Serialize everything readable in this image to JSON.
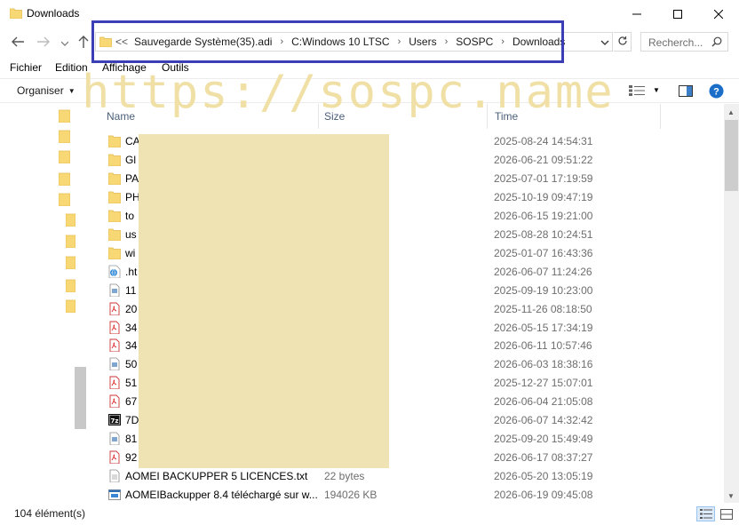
{
  "window": {
    "title": "Downloads",
    "folder_icon": "folder-icon"
  },
  "navigation": {
    "address_overflow": "<<",
    "breadcrumbs": [
      "Sauvegarde Système(35).adi",
      "C:Windows 10 LTSC",
      "Users",
      "SOSPC",
      "Downloads"
    ],
    "search_placeholder": "Recherch..."
  },
  "menu": {
    "items": [
      "Fichier",
      "Edition",
      "Affichage",
      "Outils"
    ]
  },
  "command_bar": {
    "organise_label": "Organiser"
  },
  "watermark": "https://sospc.name",
  "columns": {
    "name": "Name",
    "size": "Size",
    "time": "Time"
  },
  "files": [
    {
      "name": "CA",
      "size": "",
      "time": "2025-08-24 14:54:31",
      "icon": "folder-icon"
    },
    {
      "name": "Gl",
      "size": "",
      "time": "2026-06-21 09:51:22",
      "icon": "folder-icon"
    },
    {
      "name": "PA",
      "size": "",
      "time": "2025-07-01 17:19:59",
      "icon": "folder-icon"
    },
    {
      "name": "PH",
      "size": "",
      "time": "2025-10-19 09:47:19",
      "icon": "folder-icon"
    },
    {
      "name": "to",
      "size": "",
      "time": "2026-06-15 19:21:00",
      "icon": "folder-icon"
    },
    {
      "name": "us",
      "size": "",
      "time": "2025-08-28 10:24:51",
      "icon": "folder-icon"
    },
    {
      "name": "wi",
      "size": "",
      "time": "2025-01-07 16:43:36",
      "icon": "folder-icon"
    },
    {
      "name": ".ht",
      "size": "",
      "time": "2026-06-07 11:24:26",
      "icon": "html-file-icon"
    },
    {
      "name": "11",
      "size": "",
      "time": "2025-09-19 10:23:00",
      "icon": "image-file-icon"
    },
    {
      "name": "20",
      "size": "",
      "time": "2025-11-26 08:18:50",
      "icon": "pdf-file-icon"
    },
    {
      "name": "34",
      "size": "",
      "time": "2026-05-15 17:34:19",
      "icon": "pdf-file-icon"
    },
    {
      "name": "34",
      "size": "",
      "time": "2026-06-11 10:57:46",
      "icon": "pdf-file-icon"
    },
    {
      "name": "50",
      "size": "",
      "time": "2026-06-03 18:38:16",
      "icon": "image-file-icon"
    },
    {
      "name": "51",
      "size": "",
      "time": "2025-12-27 15:07:01",
      "icon": "pdf-file-icon"
    },
    {
      "name": "67",
      "size": "",
      "time": "2026-06-04 21:05:08",
      "icon": "pdf-file-icon"
    },
    {
      "name": "7D",
      "size": "",
      "time": "2026-06-07 14:32:42",
      "icon": "7zip-archive-icon"
    },
    {
      "name": "81",
      "size": "",
      "time": "2025-09-20 15:49:49",
      "icon": "image-file-icon"
    },
    {
      "name": "92",
      "size": "",
      "time": "2026-06-17 08:37:27",
      "icon": "pdf-file-icon"
    },
    {
      "name": "AOMEI BACKUPPER 5 LICENCES.txt",
      "size": "22 bytes",
      "time": "2026-05-20 13:05:19",
      "icon": "text-file-icon"
    },
    {
      "name": "AOMEIBackupper 8.4 téléchargé sur w...",
      "size": "194026 KB",
      "time": "2026-06-19 09:45:08",
      "icon": "exe-file-icon"
    }
  ],
  "status": {
    "item_count": "104 élément(s)"
  },
  "colors": {
    "highlight_box": "#3a3fb5",
    "redaction": "#efe3b4",
    "folder_yellow": "#f8d775",
    "header_text": "#4c607a"
  }
}
